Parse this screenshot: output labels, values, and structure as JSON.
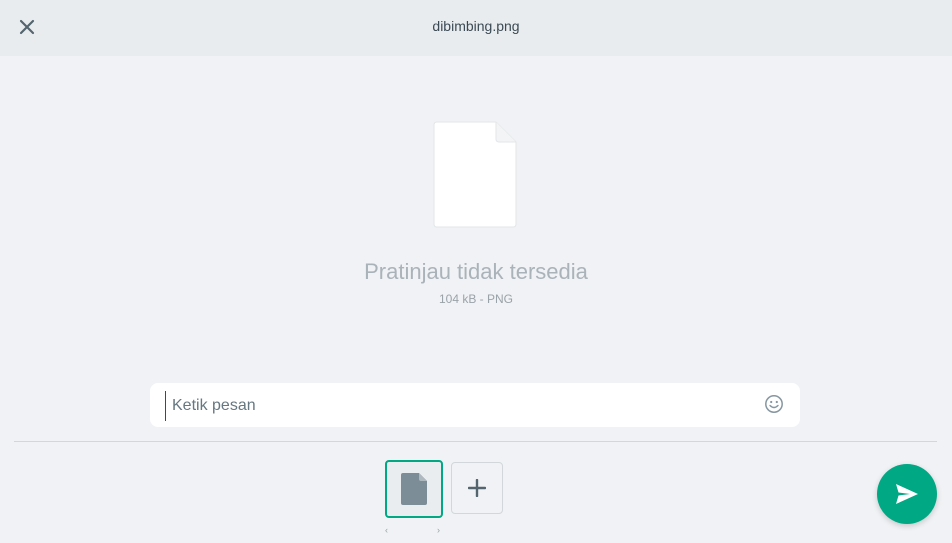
{
  "header": {
    "title": "dibimbing.png",
    "close_icon": "close-icon"
  },
  "preview": {
    "icon": "document-icon",
    "message": "Pratinjau tidak tersedia",
    "meta": "104 kB - PNG"
  },
  "caption": {
    "placeholder": "Ketik pesan",
    "value": "",
    "emoji_icon": "emoji-icon"
  },
  "thumbnails": {
    "selected_icon": "document-icon",
    "add_icon": "plus-icon",
    "prev_glyph": "‹",
    "next_glyph": "›"
  },
  "send": {
    "icon": "send-icon"
  },
  "colors": {
    "accent": "#00a884",
    "background": "#f0f2f5",
    "header": "#e9ecef"
  }
}
